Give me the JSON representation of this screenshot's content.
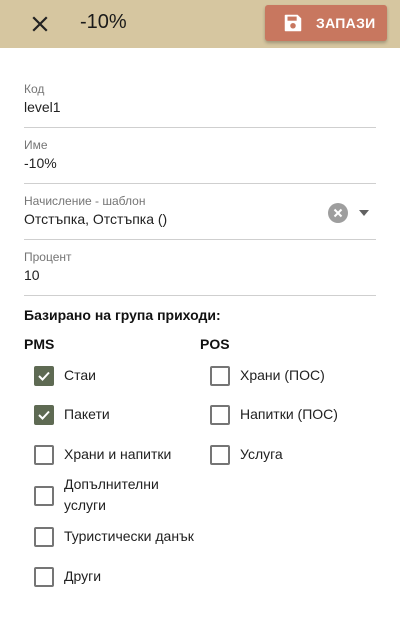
{
  "header": {
    "title": "-10%",
    "save_label": "ЗАПАЗИ",
    "icons": {
      "close": "close-icon",
      "save": "floppy-disk-icon"
    },
    "colors": {
      "bar": "#d6c6a0",
      "save_button": "#c8775f",
      "checkbox_checked": "#5e6a53"
    }
  },
  "fields": {
    "code": {
      "label": "Код",
      "value": "level1"
    },
    "name": {
      "label": "Име",
      "value": "-10%"
    },
    "template": {
      "label": "Начисление - шаблон",
      "value": "Отстъпка, Отстъпка ()"
    },
    "percent": {
      "label": "Процент",
      "value": "10"
    }
  },
  "revenue_groups": {
    "title": "Базирано на група приходи:",
    "pms": {
      "title": "PMS",
      "items": [
        {
          "label": "Стаи",
          "checked": true
        },
        {
          "label": "Пакети",
          "checked": true
        },
        {
          "label": "Храни и напитки",
          "checked": false
        },
        {
          "label": "Допълнителни услуги",
          "checked": false
        },
        {
          "label": "Туристически данък",
          "checked": false
        },
        {
          "label": "Други",
          "checked": false
        }
      ]
    },
    "pos": {
      "title": "POS",
      "items": [
        {
          "label": "Храни (ПОС)",
          "checked": false
        },
        {
          "label": "Напитки (ПОС)",
          "checked": false
        },
        {
          "label": "Услуга",
          "checked": false
        }
      ]
    }
  }
}
